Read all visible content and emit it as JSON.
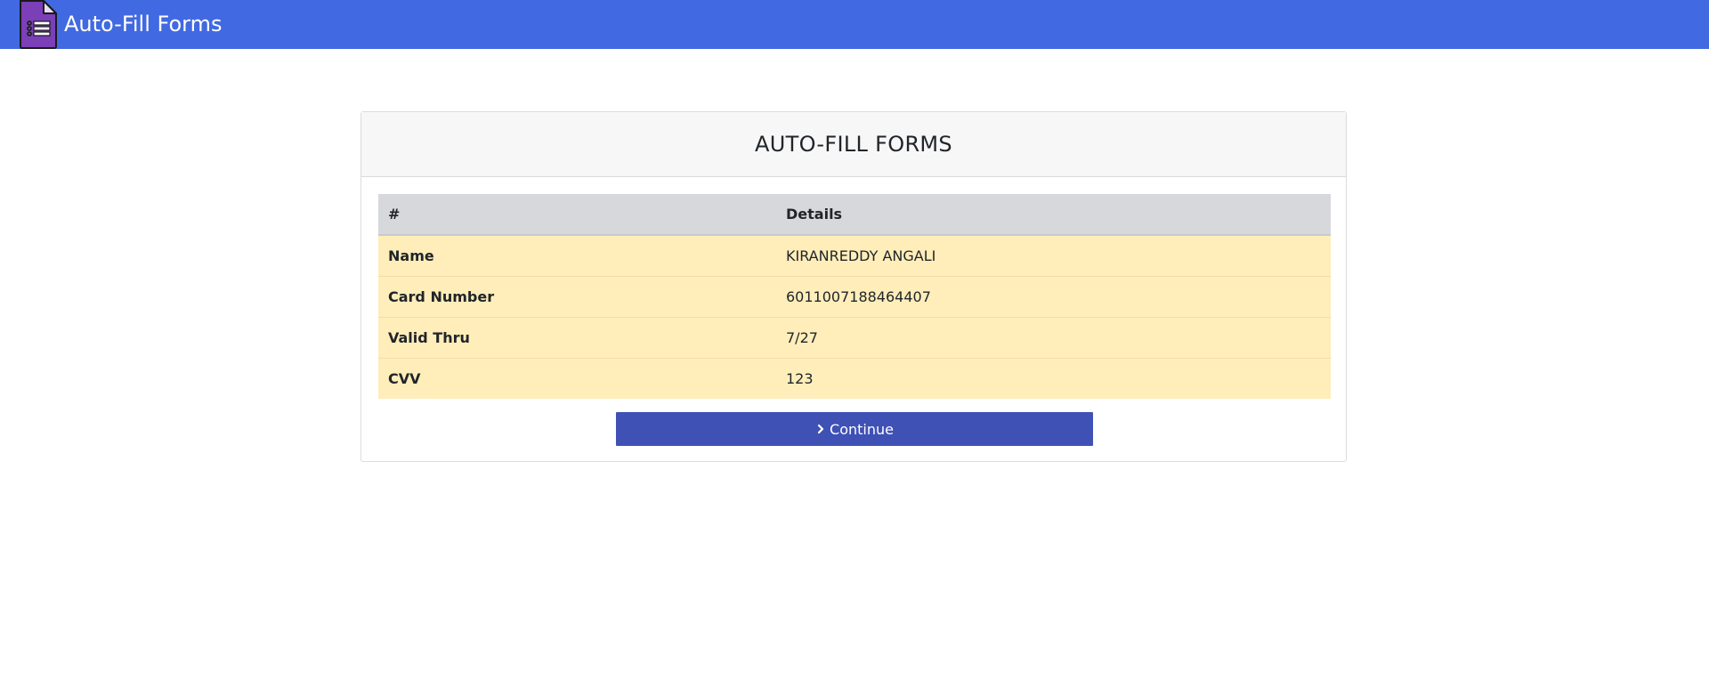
{
  "navbar": {
    "brand": "Auto-Fill Forms",
    "logo_icon": "form-list-icon",
    "color": "#4169e1"
  },
  "card": {
    "title": "AUTO-FILL FORMS",
    "table": {
      "headers": [
        "#",
        "Details"
      ],
      "rows": [
        {
          "label": "Name",
          "value": "KIRANREDDY ANGALI"
        },
        {
          "label": "Card Number",
          "value": "6011007188464407"
        },
        {
          "label": "Valid Thru",
          "value": "7/27"
        },
        {
          "label": "CVV",
          "value": "123"
        }
      ]
    },
    "continue_label": "Continue",
    "continue_icon": "chevron-right-icon",
    "button_color": "#3f51b5"
  }
}
